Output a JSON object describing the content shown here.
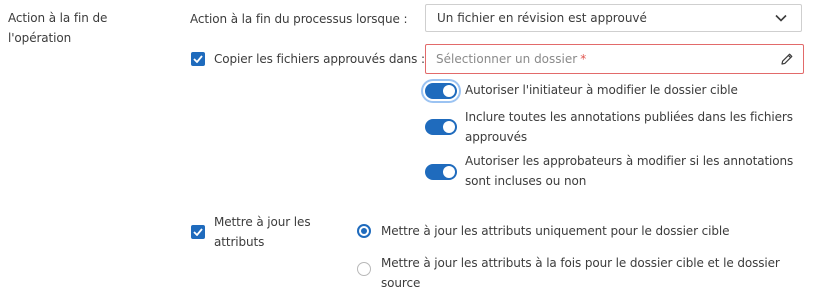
{
  "section": {
    "label_line1": "Action à la fin de",
    "label_line2": "l'opération"
  },
  "trigger": {
    "label": "Action à la fin du processus lorsque :",
    "selected": "Un fichier en révision est approuvé",
    "dropdown_icon": "chevron-down-icon"
  },
  "copy": {
    "checked": true,
    "label": "Copier les fichiers approuvés dans :",
    "folder_placeholder": "Sélectionner un dossier",
    "required_mark": "*",
    "edit_icon": "pencil-icon",
    "options": [
      {
        "on": true,
        "focused": true,
        "lines": [
          "Autoriser l'initiateur à modifier le dossier cible"
        ]
      },
      {
        "on": true,
        "focused": false,
        "lines": [
          "Inclure toutes les annotations publiées dans les fichiers",
          "approuvés"
        ]
      },
      {
        "on": true,
        "focused": false,
        "lines": [
          "Autoriser les approbateurs à modifier si les annotations",
          "sont incluses ou non"
        ]
      }
    ]
  },
  "attributes": {
    "checked": true,
    "label_line1": "Mettre à jour les",
    "label_line2": "attributs",
    "choices": [
      {
        "selected": true,
        "lines": [
          "Mettre à jour les attributs uniquement pour le dossier cible"
        ]
      },
      {
        "selected": false,
        "lines": [
          "Mettre à jour les attributs à la fois pour le dossier cible et le dossier",
          "source"
        ]
      }
    ]
  },
  "colors": {
    "accent": "#1f6bbd",
    "error_border": "#e26a6a",
    "required": "#e0554f",
    "text": "#3c3c3c",
    "placeholder": "#8a8a8a"
  }
}
